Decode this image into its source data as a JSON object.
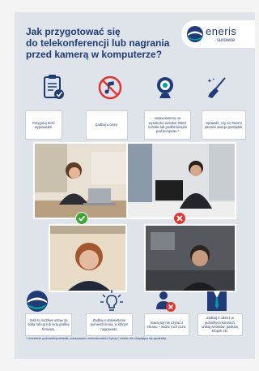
{
  "poster": {
    "title_line1": "Jak przygotować się",
    "title_line2": "do telekonferencji lub nagrania",
    "title_line3": "przed kamerą w komputerze?"
  },
  "logo": {
    "word1": "eneris",
    "word2": "surowce"
  },
  "tips_top": [
    {
      "icon": "clipboard-check-icon",
      "text": "Przygotuj treść wypowiedzi."
    },
    {
      "icon": "no-music-icon",
      "text": "Zadbaj o ciszę."
    },
    {
      "icon": "webcam-icon",
      "text": "Ustaw kamerę na wysokości wzroku! Obniż krzesło lub podłóż książki pod komputer.*"
    },
    {
      "icon": "broom-icon",
      "text": "Sprawdź, czy za Twoimi plecami panuje porządek."
    }
  ],
  "tips_bottom": [
    {
      "icon": "eneris-logo-icon",
      "text": "Jeśli to możliwe ustaw za sobą roll-up lub inną grafikę firmową."
    },
    {
      "icon": "lightbulb-icon",
      "text": "Zadbaj o doświetlenie pomieszczenia, w którym nagrywasz."
    },
    {
      "icon": "person-reading-icon",
      "text": "Staraj się nie czytać z ekranu – widać ruch oczu."
    },
    {
      "icon": "suit-icon",
      "text": "Zadbaj o odzież w jednolitych kolorach, unikaj wzorków: pasków, kropek etc."
    }
  ],
  "footer": "* Uniesienie podstawki/podkładki, pokazywanie niedoskonałości fryzury i widoku źle ukłądajęcy się gardeskip.",
  "colors": {
    "brand": "#1f3b78",
    "accent": "#00a1a1",
    "good": "#3fa535",
    "bad": "#e3342f"
  }
}
